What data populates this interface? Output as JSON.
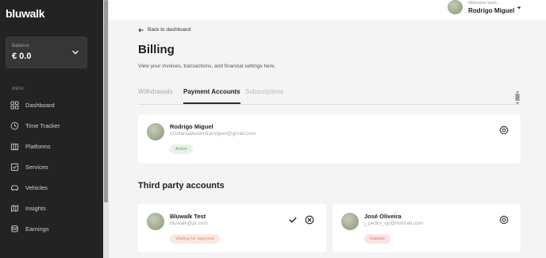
{
  "sidebar": {
    "logo": "bluwalk",
    "balance": {
      "label": "Balance",
      "value": "€ 0.0"
    },
    "menu_label": "MENU",
    "items": [
      {
        "label": "Dashboard",
        "icon": "grid-icon"
      },
      {
        "label": "Time Tracker",
        "icon": "clock-icon"
      },
      {
        "label": "Platforms",
        "icon": "building-icon"
      },
      {
        "label": "Services",
        "icon": "checkbox-icon"
      },
      {
        "label": "Vehicles",
        "icon": "car-icon"
      },
      {
        "label": "Insights",
        "icon": "map-icon"
      },
      {
        "label": "Earnings",
        "icon": "coins-icon"
      }
    ]
  },
  "header": {
    "welcome": "Welcome back,",
    "user_name": "Rodrigo Miguel"
  },
  "main": {
    "back_label": "Back to dashboard",
    "title": "Billing",
    "subtitle": "View your invoices, transactions, and financial settings here.",
    "tabs": [
      {
        "label": "Withdrawals",
        "active": false
      },
      {
        "label": "Payment Accounts",
        "active": true
      },
      {
        "label": "Subscriptions",
        "active": false
      }
    ],
    "primary_account": {
      "name": "Rodrigo Miguel",
      "email": "cristianaalexandramiguel@gmail.com",
      "status": "Active"
    },
    "third_party_title": "Third party accounts",
    "third_party_accounts": [
      {
        "name": "Bluwalk Test",
        "email": "bluwalk@pt.com",
        "status": "Waiting for approval"
      },
      {
        "name": "José Oliveira",
        "email": "j_pedro_op@hotmail.com",
        "status": "Inactive"
      }
    ]
  },
  "colors": {
    "sidebar_bg": "#232323",
    "active_badge": "#67a274",
    "waiting_badge": "#d9917a",
    "inactive_badge": "#d97777"
  }
}
